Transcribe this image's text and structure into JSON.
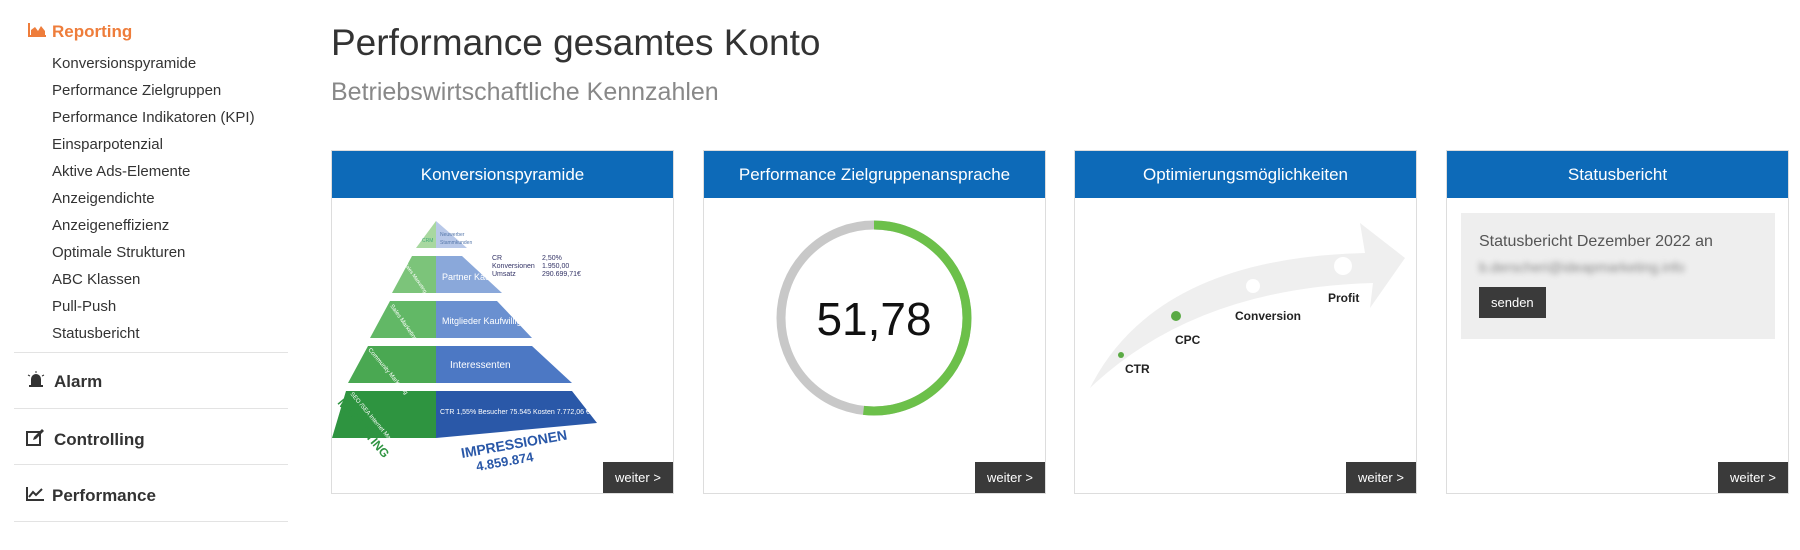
{
  "sidebar": {
    "reporting": {
      "label": "Reporting",
      "icon": "area-chart-icon",
      "color": "#ee7d3b",
      "items": [
        "Konversionspyramide",
        "Performance Zielgruppen",
        "Performance Indikatoren (KPI)",
        "Einsparpotenzial",
        "Aktive Ads-Elemente",
        "Anzeigendichte",
        "Anzeigeneffizienz",
        "Optimale Strukturen",
        "ABC Klassen",
        "Pull-Push",
        "Statusbericht"
      ]
    },
    "sections": [
      {
        "label": "Alarm",
        "icon": "siren-icon"
      },
      {
        "label": "Controlling",
        "icon": "edit-icon"
      },
      {
        "label": "Performance",
        "icon": "line-chart-icon"
      }
    ]
  },
  "header": {
    "title": "Performance gesamtes Konto",
    "subtitle": "Betriebswirtschaftliche Kennzahlen"
  },
  "cards": {
    "weiter_label": "weiter >",
    "header_color": "#0d6ab8",
    "pyramid": {
      "title": "Konversionspyramide",
      "top": {
        "left": "CRM",
        "right1": "Neuwerber",
        "right2": "Stammkunden"
      },
      "levels": [
        {
          "left": "Sales Marketing",
          "right": "Partner Käufer"
        },
        {
          "left": "Sales Marketing",
          "right": "Mitglieder Kaufwillige"
        },
        {
          "left": "Community Marketing",
          "right": "Interessenten"
        },
        {
          "left": "SEO /SEA Internet Marketing",
          "right": "CTR 1,55% Besucher 75.545 Kosten 7.772,06 €"
        }
      ],
      "stats": [
        [
          "CR",
          "2,50%"
        ],
        [
          "Konversionen",
          "1.950,00"
        ],
        [
          "Umsatz",
          "290.699,71€"
        ]
      ],
      "marketing": "MARKETING",
      "impressions_label": "IMPRESSIONEN",
      "impressions": "4.859.874"
    },
    "gauge": {
      "title": "Performance Zielgruppenansprache",
      "value": "51,78",
      "percent": 51.78,
      "fill_color": "#6cc04a",
      "track_color": "#c8c8c8"
    },
    "optim": {
      "title": "Optimierungsmöglichkeiten",
      "labels": [
        "CTR",
        "CPC",
        "Conversion",
        "Profit"
      ]
    },
    "status": {
      "title": "Statusbericht",
      "text": "Statusbericht Dezember 2022 an",
      "email": "b.derscheri@ideapmarketing.info",
      "button": "senden"
    }
  }
}
